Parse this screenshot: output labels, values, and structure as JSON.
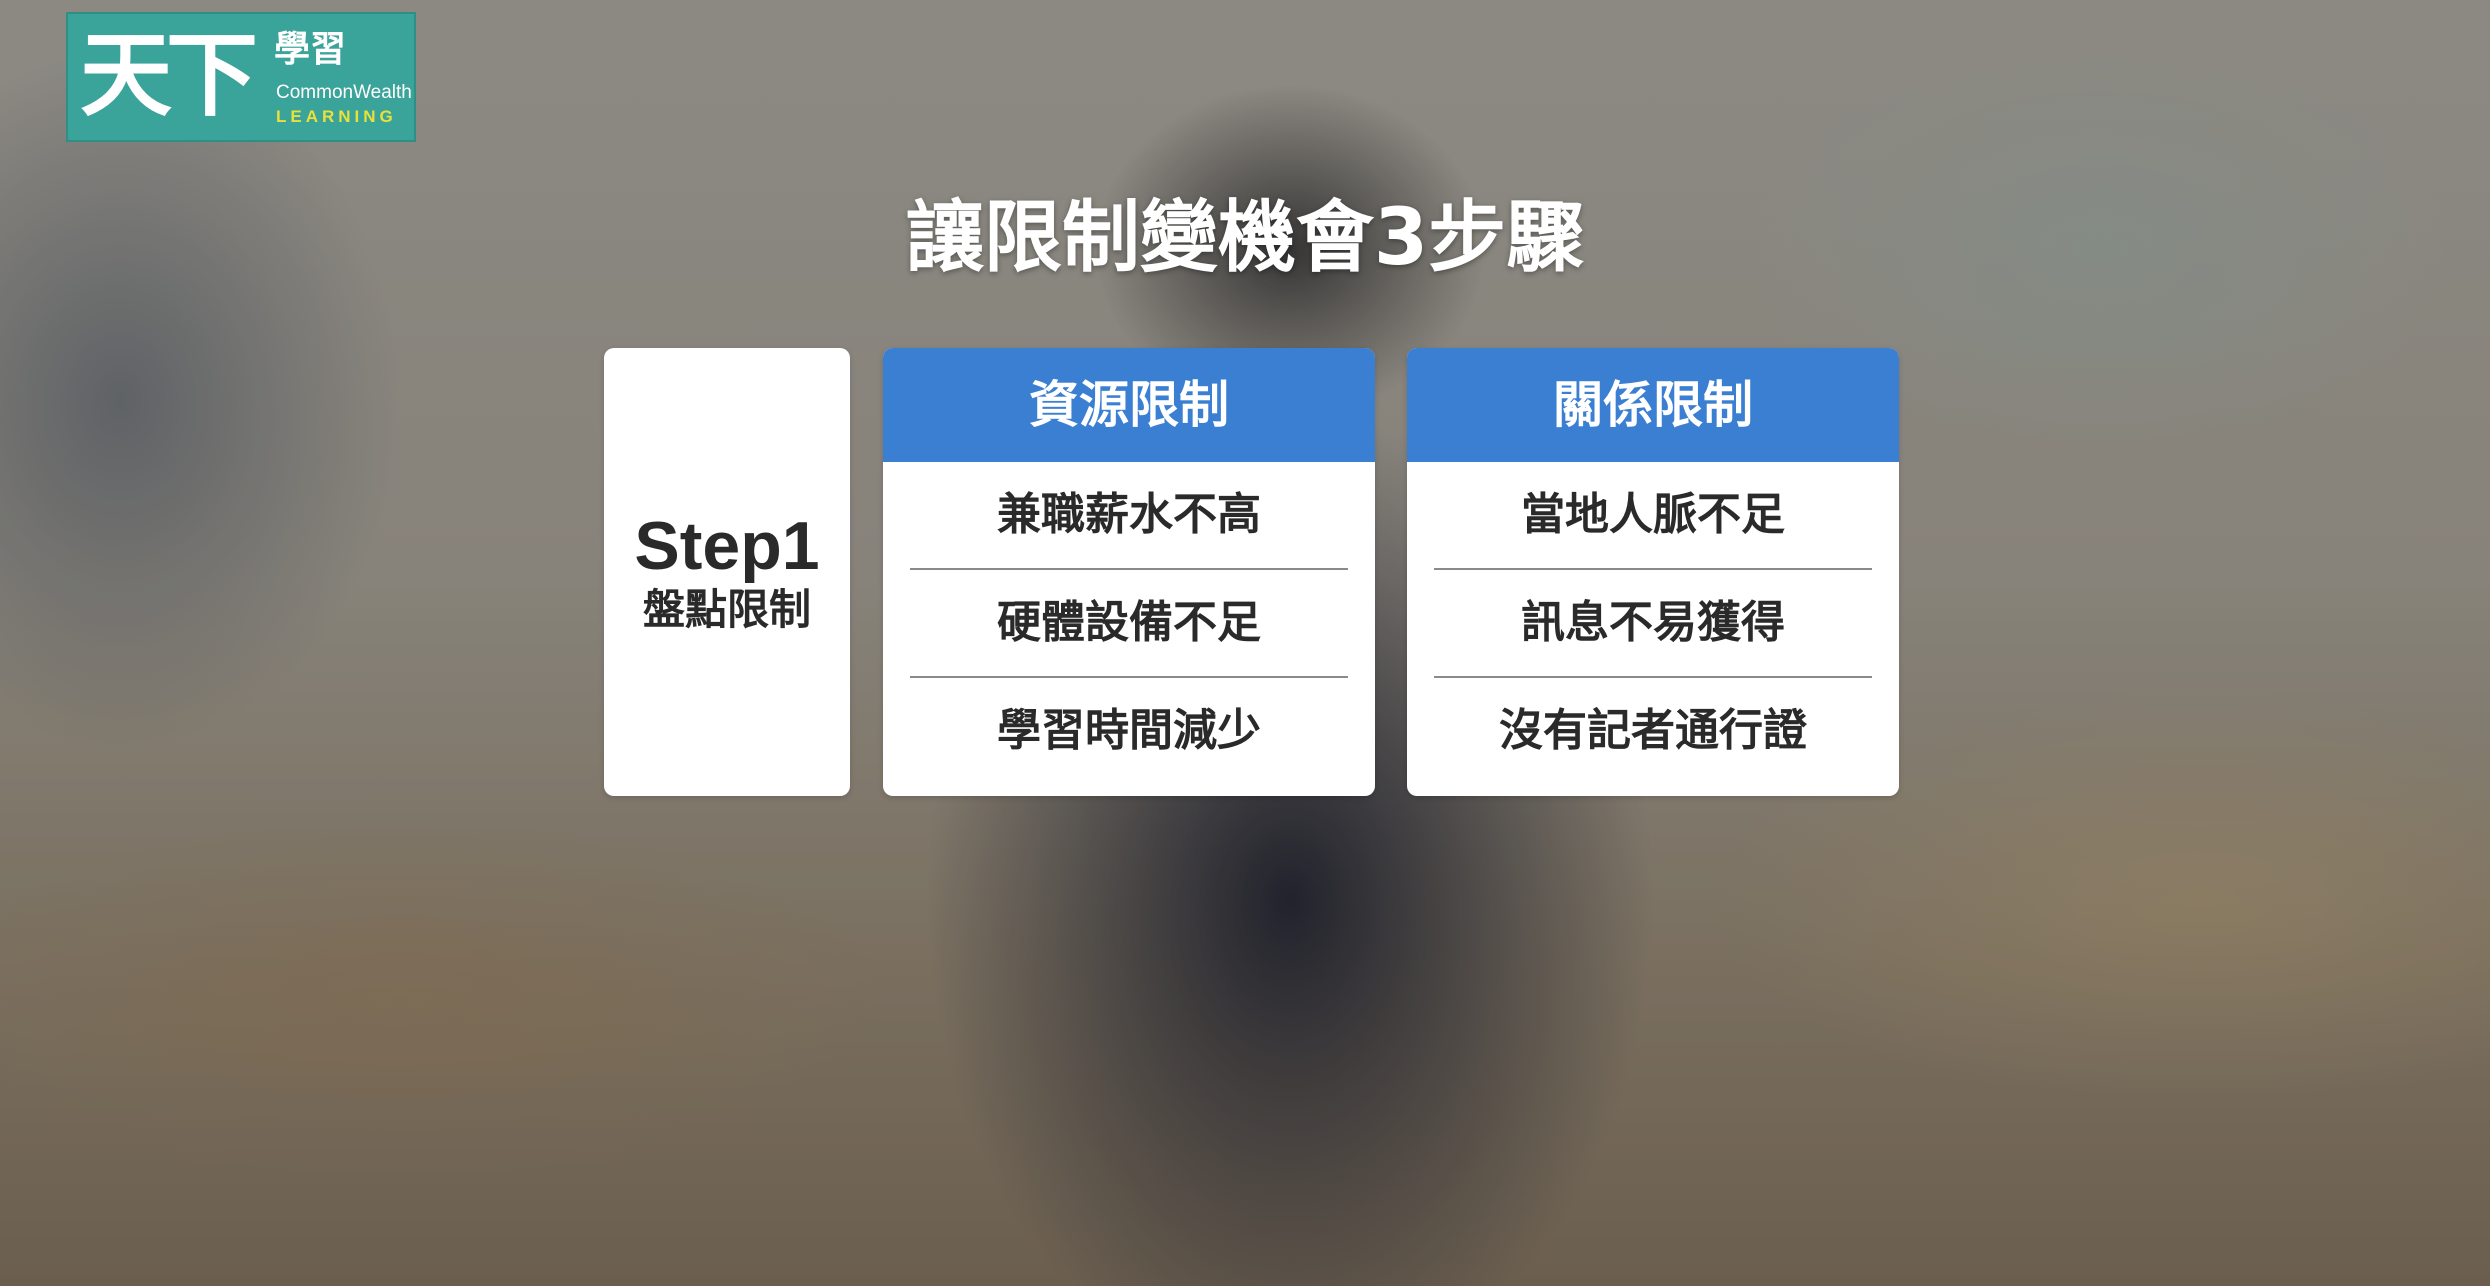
{
  "logo": {
    "main": "天下",
    "sub": "學習",
    "en_line1": "CommonWealth",
    "en_line2": "LEARNING"
  },
  "title": "讓限制變機會3步驟",
  "step": {
    "number": "Step1",
    "label": "盤點限制"
  },
  "categories": [
    {
      "header": "資源限制",
      "items": [
        "兼職薪水不高",
        "硬體設備不足",
        "學習時間減少"
      ]
    },
    {
      "header": "關係限制",
      "items": [
        "當地人脈不足",
        "訊息不易獲得",
        "沒有記者通行證"
      ]
    }
  ],
  "colors": {
    "header_blue": "#3a7fd2",
    "logo_teal": "#3aa39a",
    "logo_yellow": "#e9e03a"
  }
}
